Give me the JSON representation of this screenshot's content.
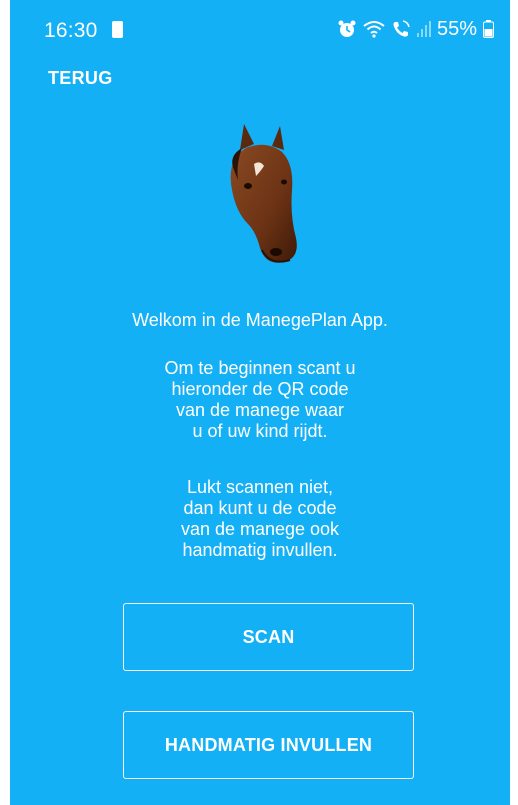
{
  "status_bar": {
    "time": "16:30",
    "battery": "55%",
    "icons": [
      "sim-card-icon",
      "alarm-icon",
      "wifi-icon",
      "wifi-call-icon",
      "signal-icon",
      "battery-icon"
    ]
  },
  "nav": {
    "back_label": "TERUG"
  },
  "logo": {
    "icon": "horse-head-icon"
  },
  "content": {
    "welcome": "Welkom in de ManegePlan App.",
    "intro_lines": [
      "Om te beginnen scant u",
      "hieronder de QR code",
      "van de manege waar",
      "u of uw kind rijdt."
    ],
    "fallback_lines": [
      "Lukt scannen niet,",
      "dan kunt u de code",
      "van de manege ook",
      "handmatig invullen."
    ]
  },
  "buttons": {
    "scan_label": "SCAN",
    "manual_label": "HANDMATIG INVULLEN"
  },
  "colors": {
    "background": "#14b0f6",
    "text": "#ffffff"
  }
}
